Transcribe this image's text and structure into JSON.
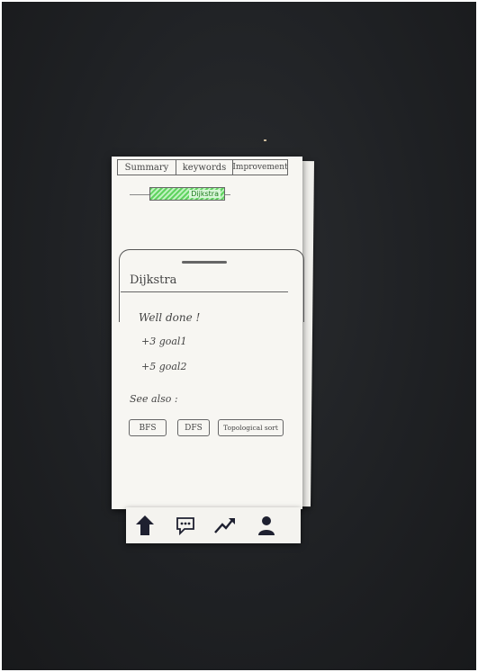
{
  "tabs": [
    {
      "label": "Summary"
    },
    {
      "label": "keywords"
    },
    {
      "label": "Improvement"
    }
  ],
  "breadcrumb": {
    "label": "Dijkstra"
  },
  "card": {
    "title": "Dijkstra",
    "message": "Well done !",
    "goals": [
      "+3 goal1",
      "+5 goal2"
    ],
    "see_also_label": "See also :",
    "related": [
      "BFS",
      "DFS",
      "Topological sort"
    ]
  },
  "bottom_nav": [
    {
      "icon": "home-icon"
    },
    {
      "icon": "chat-icon"
    },
    {
      "icon": "trending-icon"
    },
    {
      "icon": "profile-icon"
    }
  ],
  "colors": {
    "background": "#1f2124",
    "paper": "#f7f6f2",
    "highlight": "#5fd35f",
    "ink": "#444444"
  }
}
